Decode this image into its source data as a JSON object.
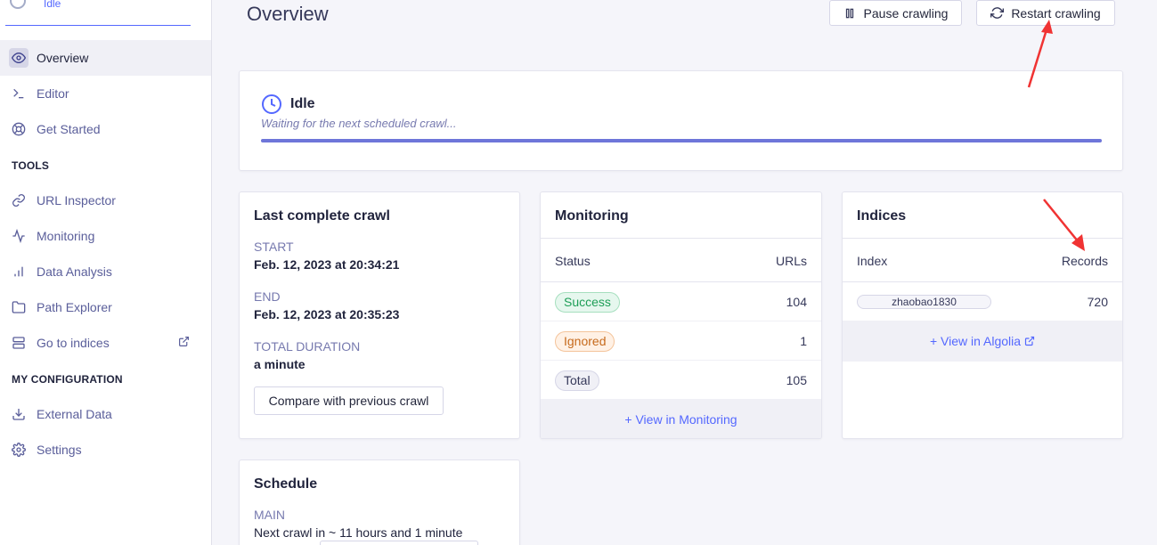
{
  "sidebar": {
    "status": "Idle",
    "items": [
      {
        "label": "Overview",
        "icon": "eye-icon"
      },
      {
        "label": "Editor",
        "icon": "terminal-icon"
      },
      {
        "label": "Get Started",
        "icon": "lifebuoy-icon"
      },
      {
        "label": "URL Inspector",
        "icon": "link-icon"
      },
      {
        "label": "Monitoring",
        "icon": "activity-icon"
      },
      {
        "label": "Data Analysis",
        "icon": "bar-chart-icon"
      },
      {
        "label": "Path Explorer",
        "icon": "folder-icon"
      },
      {
        "label": "Go to indices",
        "icon": "database-icon"
      },
      {
        "label": "External Data",
        "icon": "download-icon"
      },
      {
        "label": "Settings",
        "icon": "gear-icon"
      }
    ],
    "sections": {
      "tools": "TOOLS",
      "config": "MY CONFIGURATION"
    }
  },
  "header": {
    "title": "Overview",
    "pause_label": "Pause crawling",
    "restart_label": "Restart crawling"
  },
  "status_card": {
    "title": "Idle",
    "subtitle": "Waiting for the next scheduled crawl...",
    "progress": 1.0
  },
  "last_crawl": {
    "title": "Last complete crawl",
    "start_label": "START",
    "start_value": "Feb. 12, 2023 at 20:34:21",
    "end_label": "END",
    "end_value": "Feb. 12, 2023 at 20:35:23",
    "duration_label": "TOTAL DURATION",
    "duration_value": "a minute",
    "compare_label": "Compare with previous crawl"
  },
  "monitoring": {
    "title": "Monitoring",
    "col_status": "Status",
    "col_urls": "URLs",
    "rows": [
      {
        "status": "Success",
        "urls": "104"
      },
      {
        "status": "Ignored",
        "urls": "1"
      },
      {
        "status": "Total",
        "urls": "105"
      }
    ],
    "footer": "+ View in Monitoring"
  },
  "indices": {
    "title": "Indices",
    "col_index": "Index",
    "col_records": "Records",
    "rows": [
      {
        "index": "zhaobao1830",
        "records": "720"
      }
    ],
    "footer": "+ View in Algolia"
  },
  "schedule": {
    "title": "Schedule",
    "main_label": "MAIN",
    "next_crawl": "Next crawl in ~ 11 hours and 1 minute"
  },
  "colors": {
    "accent": "#5468ff",
    "annotation_arrow": "#f03333",
    "success_bg": "#e6f7ee",
    "success_fg": "#1e9e57",
    "ignored_bg": "#fff1e5",
    "ignored_fg": "#c66a1c"
  }
}
